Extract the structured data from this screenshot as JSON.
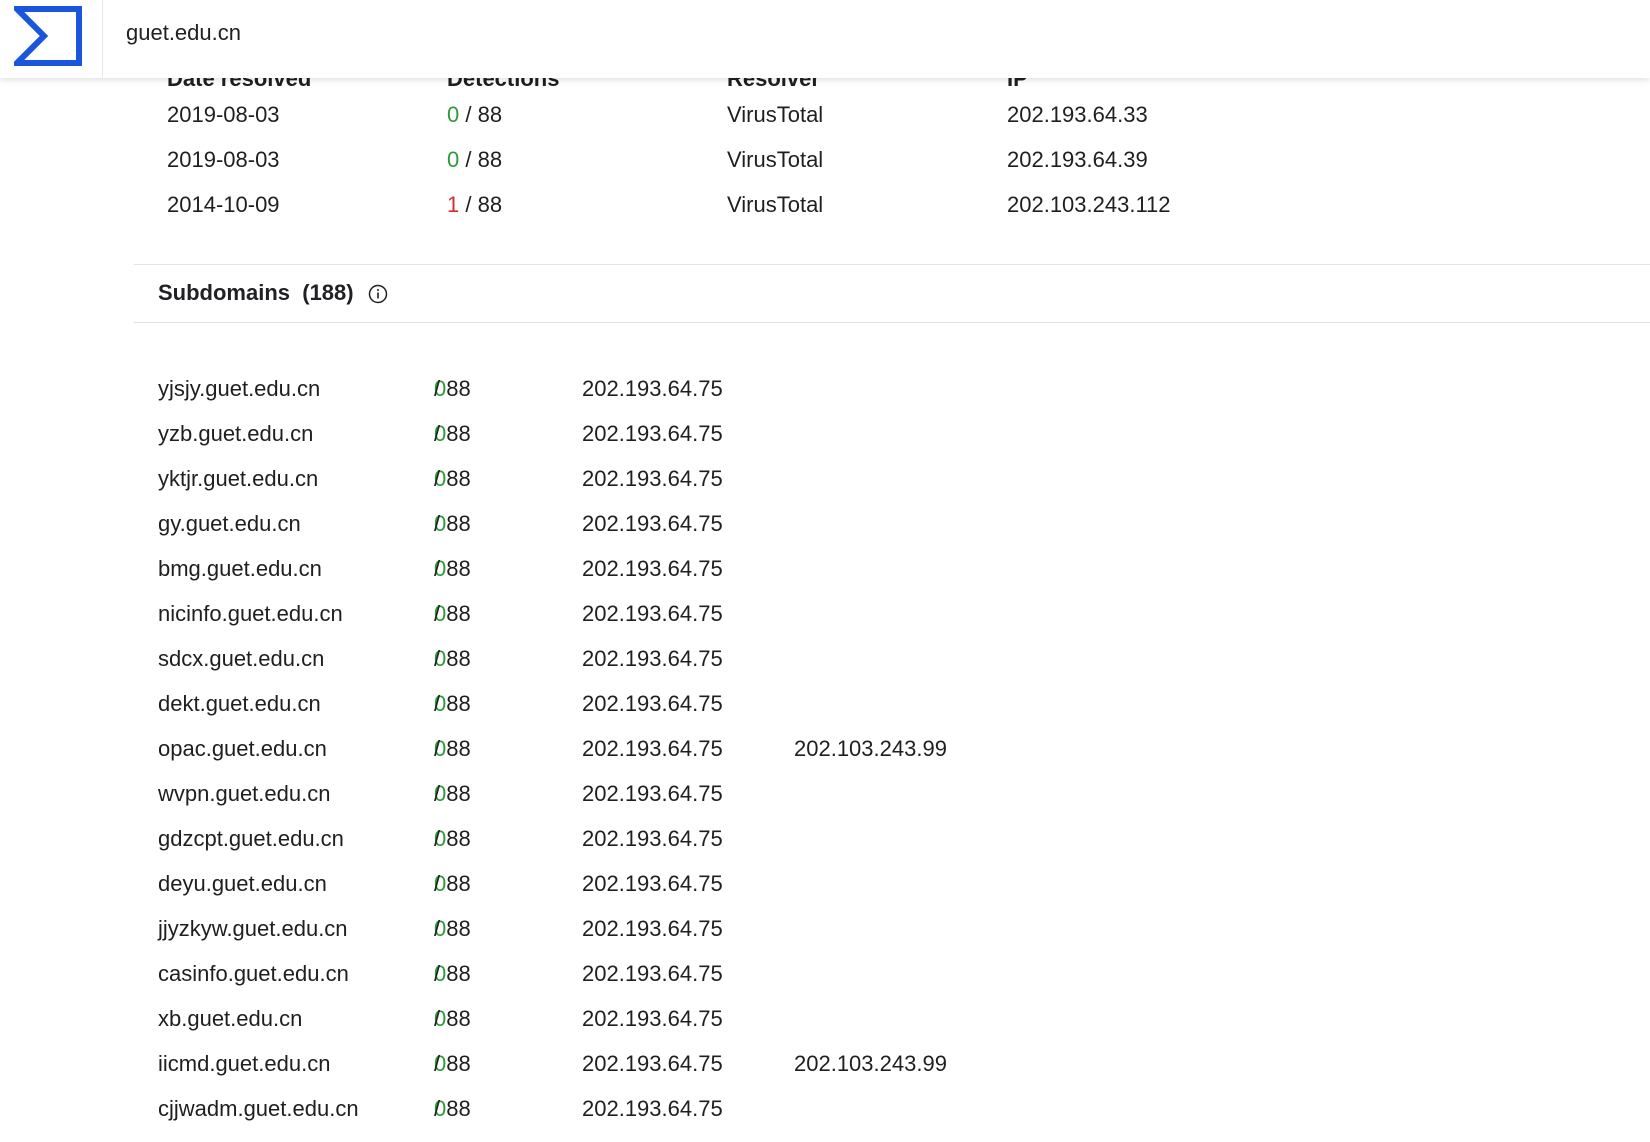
{
  "header": {
    "search_value": "guet.edu.cn",
    "logo_color": "#1a56db"
  },
  "resolutions": {
    "columns": [
      "Date resolved",
      "Detections",
      "Resolver",
      "IP"
    ],
    "rows": [
      {
        "date": "2019-08-03",
        "positives": "0",
        "total": " / 88",
        "resolver": "VirusTotal",
        "ip": "202.193.64.33"
      },
      {
        "date": "2019-08-03",
        "positives": "0",
        "total": " / 88",
        "resolver": "VirusTotal",
        "ip": "202.193.64.39"
      },
      {
        "date": "2014-10-09",
        "positives": "1",
        "total": " / 88",
        "resolver": "VirusTotal",
        "ip": "202.103.243.112"
      }
    ]
  },
  "subdomains": {
    "title": "Subdomains",
    "count": "(188)",
    "info_icon": "info-circle-icon",
    "rows": [
      {
        "name": "yjsjy.guet.edu.cn",
        "positives": "0",
        "total": " / 88",
        "ip1": "202.193.64.75",
        "ip2": ""
      },
      {
        "name": "yzb.guet.edu.cn",
        "positives": "0",
        "total": " / 88",
        "ip1": "202.193.64.75",
        "ip2": ""
      },
      {
        "name": "yktjr.guet.edu.cn",
        "positives": "0",
        "total": " / 88",
        "ip1": "202.193.64.75",
        "ip2": ""
      },
      {
        "name": "gy.guet.edu.cn",
        "positives": "0",
        "total": " / 88",
        "ip1": "202.193.64.75",
        "ip2": ""
      },
      {
        "name": "bmg.guet.edu.cn",
        "positives": "0",
        "total": " / 88",
        "ip1": "202.193.64.75",
        "ip2": ""
      },
      {
        "name": "nicinfo.guet.edu.cn",
        "positives": "0",
        "total": " / 88",
        "ip1": "202.193.64.75",
        "ip2": ""
      },
      {
        "name": "sdcx.guet.edu.cn",
        "positives": "0",
        "total": " / 88",
        "ip1": "202.193.64.75",
        "ip2": ""
      },
      {
        "name": "dekt.guet.edu.cn",
        "positives": "0",
        "total": " / 88",
        "ip1": "202.193.64.75",
        "ip2": ""
      },
      {
        "name": "opac.guet.edu.cn",
        "positives": "0",
        "total": " / 88",
        "ip1": "202.193.64.75",
        "ip2": "202.103.243.99"
      },
      {
        "name": "wvpn.guet.edu.cn",
        "positives": "0",
        "total": " / 88",
        "ip1": "202.193.64.75",
        "ip2": ""
      },
      {
        "name": "gdzcpt.guet.edu.cn",
        "positives": "0",
        "total": " / 88",
        "ip1": "202.193.64.75",
        "ip2": ""
      },
      {
        "name": "deyu.guet.edu.cn",
        "positives": "0",
        "total": " / 88",
        "ip1": "202.193.64.75",
        "ip2": ""
      },
      {
        "name": "jjyzkyw.guet.edu.cn",
        "positives": "0",
        "total": " / 88",
        "ip1": "202.193.64.75",
        "ip2": ""
      },
      {
        "name": "casinfo.guet.edu.cn",
        "positives": "0",
        "total": " / 88",
        "ip1": "202.193.64.75",
        "ip2": ""
      },
      {
        "name": "xb.guet.edu.cn",
        "positives": "0",
        "total": " / 88",
        "ip1": "202.193.64.75",
        "ip2": ""
      },
      {
        "name": "iicmd.guet.edu.cn",
        "positives": "0",
        "total": " / 88",
        "ip1": "202.193.64.75",
        "ip2": "202.103.243.99"
      },
      {
        "name": "cjjwadm.guet.edu.cn",
        "positives": "0",
        "total": " / 88",
        "ip1": "202.193.64.75",
        "ip2": ""
      }
    ]
  },
  "colors": {
    "clean": "#2e9b3a",
    "malicious": "#d32f2f"
  }
}
